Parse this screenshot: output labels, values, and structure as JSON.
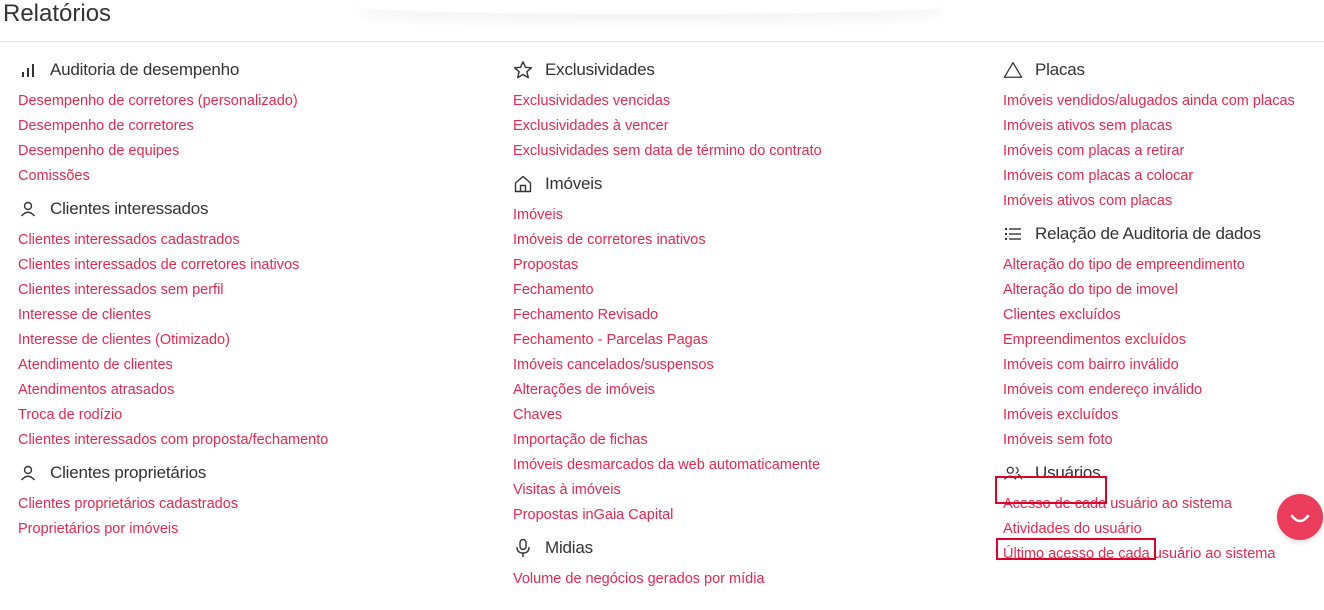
{
  "page": {
    "title": "Relatórios"
  },
  "columns": [
    {
      "sections": [
        {
          "key": "auditoria",
          "icon": "bar-chart-icon",
          "title": "Auditoria de desempenho",
          "links": [
            "Desempenho de corretores (personalizado)",
            "Desempenho de corretores",
            "Desempenho de equipes",
            "Comissões"
          ]
        },
        {
          "key": "clientes-interessados",
          "icon": "user-icon",
          "title": "Clientes interessados",
          "links": [
            "Clientes interessados cadastrados",
            "Clientes interessados de corretores inativos",
            "Clientes interessados sem perfil",
            "Interesse de clientes",
            "Interesse de clientes (Otimizado)",
            "Atendimento de clientes",
            "Atendimentos atrasados",
            "Troca de rodízio",
            "Clientes interessados com proposta/fechamento"
          ]
        },
        {
          "key": "clientes-proprietarios",
          "icon": "user-icon",
          "title": "Clientes proprietários",
          "links": [
            "Clientes proprietários cadastrados",
            "Proprietários por imóveis"
          ]
        }
      ]
    },
    {
      "sections": [
        {
          "key": "exclusividades",
          "icon": "star-icon",
          "title": "Exclusividades",
          "links": [
            "Exclusividades vencidas",
            "Exclusividades à vencer",
            "Exclusividades sem data de término do contrato"
          ]
        },
        {
          "key": "imoveis",
          "icon": "home-icon",
          "title": "Imóveis",
          "links": [
            "Imóveis",
            "Imóveis de corretores inativos",
            "Propostas",
            "Fechamento",
            "Fechamento Revisado",
            "Fechamento - Parcelas Pagas",
            "Imóveis cancelados/suspensos",
            "Alterações de imóveis",
            "Chaves",
            "Importação de fichas",
            "Imóveis desmarcados da web automaticamente",
            "Visitas à imóveis",
            "Propostas inGaia Capital"
          ]
        },
        {
          "key": "midias",
          "icon": "microphone-icon",
          "title": "Midias",
          "links": [
            "Volume de negócios gerados por mídia"
          ]
        }
      ]
    },
    {
      "sections": [
        {
          "key": "placas",
          "icon": "triangle-icon",
          "title": "Placas",
          "links": [
            "Imóveis vendidos/alugados ainda com placas",
            "Imóveis ativos sem placas",
            "Imóveis com placas a retirar",
            "Imóveis com placas a colocar",
            "Imóveis ativos com placas"
          ]
        },
        {
          "key": "relacao-auditoria",
          "icon": "list-icon",
          "title": "Relação de Auditoria de dados",
          "links": [
            "Alteração do tipo de empreendimento",
            "Alteração do tipo de imovel",
            "Clientes excluídos",
            "Empreendimentos excluídos",
            "Imóveis com bairro inválido",
            "Imóveis com endereço inválido",
            "Imóveis excluídos",
            "Imóveis sem foto"
          ]
        },
        {
          "key": "usuarios",
          "icon": "users-icon",
          "title": "Usuários",
          "links": [
            "Acesso de cada usuário ao sistema",
            "Atividades do usuário",
            "Último acesso de cada usuário ao sistema"
          ]
        }
      ]
    }
  ],
  "colors": {
    "link": "#e5284f",
    "highlight": "#e0002a",
    "chat": "#ec3c5b"
  },
  "chat": {
    "icon": "chat-smile-icon"
  }
}
